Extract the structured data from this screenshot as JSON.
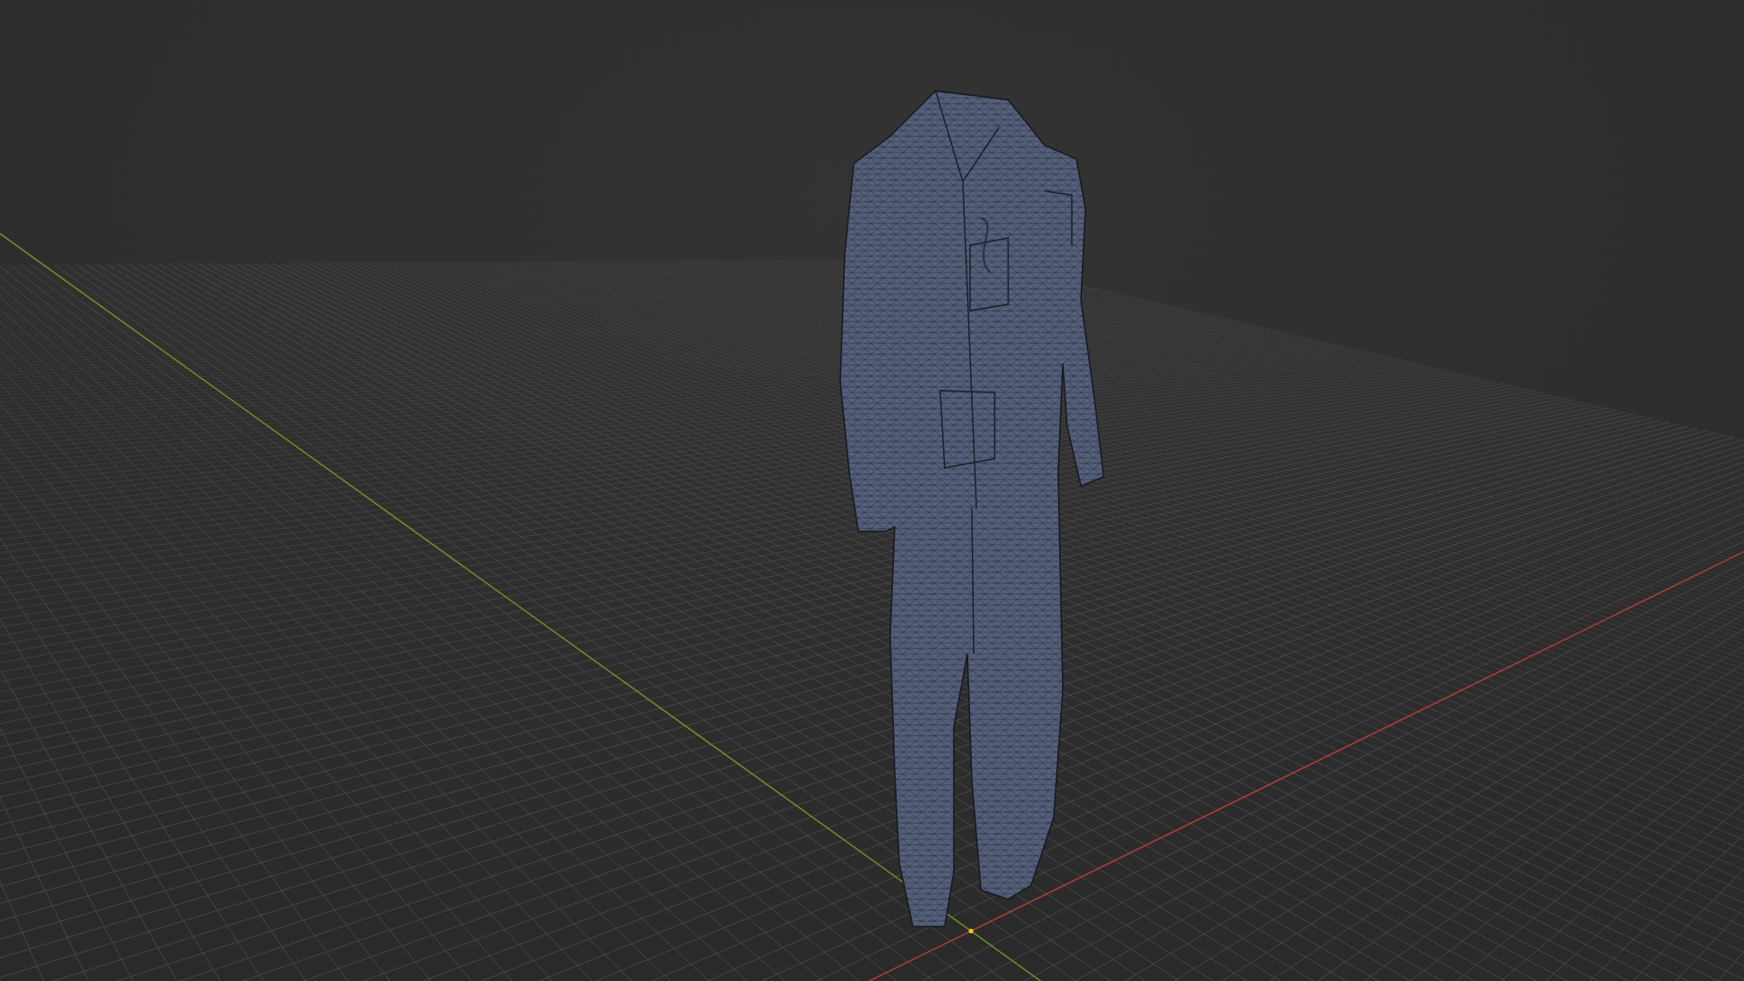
{
  "viewport": {
    "grid": {
      "visible": true
    },
    "axes": [
      {
        "kind": "x",
        "color": "#b23c3c"
      },
      {
        "kind": "y",
        "color": "#6f8f24"
      }
    ],
    "object": {
      "kind": "mesh",
      "wireframe": true
    },
    "origin_marker": true
  }
}
